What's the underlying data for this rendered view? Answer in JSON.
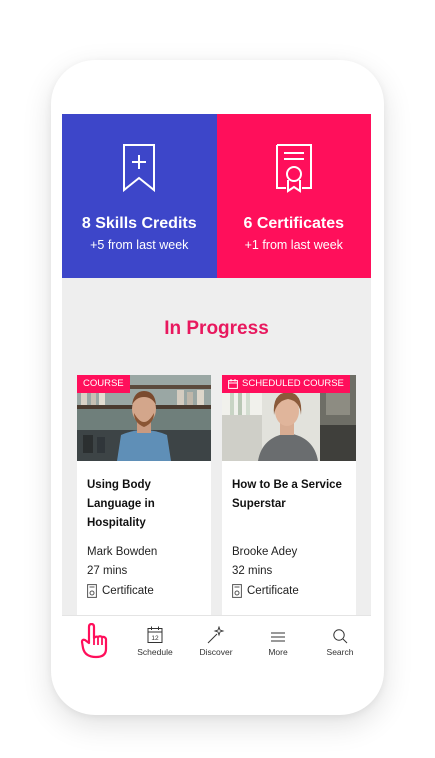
{
  "stats": [
    {
      "title": "8 Skills Credits",
      "sub": "+5 from last week",
      "icon": "bookmark-plus-icon",
      "color": "#3d46c9"
    },
    {
      "title": "6 Certificates",
      "sub": "+1 from last week",
      "icon": "certificate-icon",
      "color": "#ff0f5b"
    }
  ],
  "section_title": "In Progress",
  "cards": [
    {
      "badge": "COURSE",
      "title": "Using Body Language in Hospitality",
      "author": "Mark Bowden",
      "duration": "27 mins",
      "certificate": "Certificate"
    },
    {
      "badge": "SCHEDULED COURSE",
      "title": "How to Be a Service Superstar",
      "author": "Brooke Adey",
      "duration": "32 mins",
      "certificate": "Certificate"
    }
  ],
  "nav": {
    "calendar_day": "12",
    "items": [
      {
        "label": "Schedule"
      },
      {
        "label": "Discover"
      },
      {
        "label": "More"
      },
      {
        "label": "Search"
      }
    ]
  },
  "colors": {
    "accent": "#ff0f5b",
    "brand_blue": "#3d46c9",
    "heading": "#e8185e"
  }
}
